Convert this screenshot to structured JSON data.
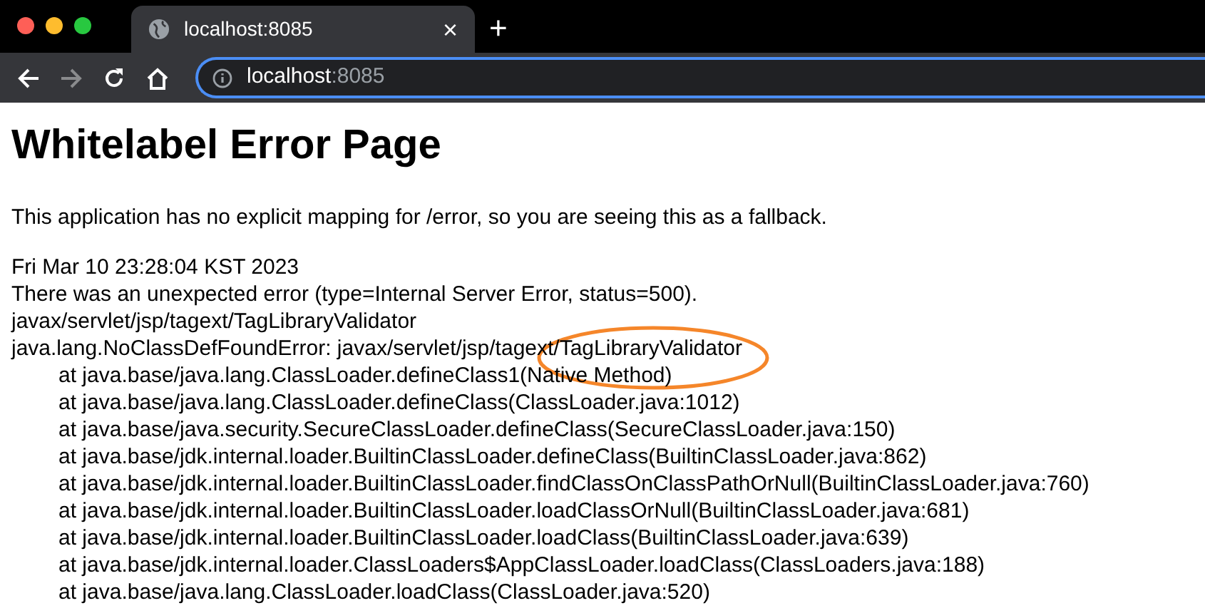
{
  "browser": {
    "tab": {
      "title": "localhost:8085",
      "close": "×"
    },
    "new_tab": "+",
    "address": {
      "host": "localhost",
      "port": ":8085"
    }
  },
  "page": {
    "heading": "Whitelabel Error Page",
    "message": "This application has no explicit mapping for /error, so you are seeing this as a fallback.",
    "lines": [
      "Fri Mar 10 23:28:04 KST 2023",
      "There was an unexpected error (type=Internal Server Error, status=500).",
      "javax/servlet/jsp/tagext/TagLibraryValidator",
      "java.lang.NoClassDefFoundError: javax/servlet/jsp/tagext/TagLibraryValidator"
    ],
    "stack": [
      "at java.base/java.lang.ClassLoader.defineClass1(Native Method)",
      "at java.base/java.lang.ClassLoader.defineClass(ClassLoader.java:1012)",
      "at java.base/java.security.SecureClassLoader.defineClass(SecureClassLoader.java:150)",
      "at java.base/jdk.internal.loader.BuiltinClassLoader.defineClass(BuiltinClassLoader.java:862)",
      "at java.base/jdk.internal.loader.BuiltinClassLoader.findClassOnClassPathOrNull(BuiltinClassLoader.java:760)",
      "at java.base/jdk.internal.loader.BuiltinClassLoader.loadClassOrNull(BuiltinClassLoader.java:681)",
      "at java.base/jdk.internal.loader.BuiltinClassLoader.loadClass(BuiltinClassLoader.java:639)",
      "at java.base/jdk.internal.loader.ClassLoaders$AppClassLoader.loadClass(ClassLoaders.java:188)",
      "at java.base/java.lang.ClassLoader.loadClass(ClassLoader.java:520)"
    ]
  }
}
